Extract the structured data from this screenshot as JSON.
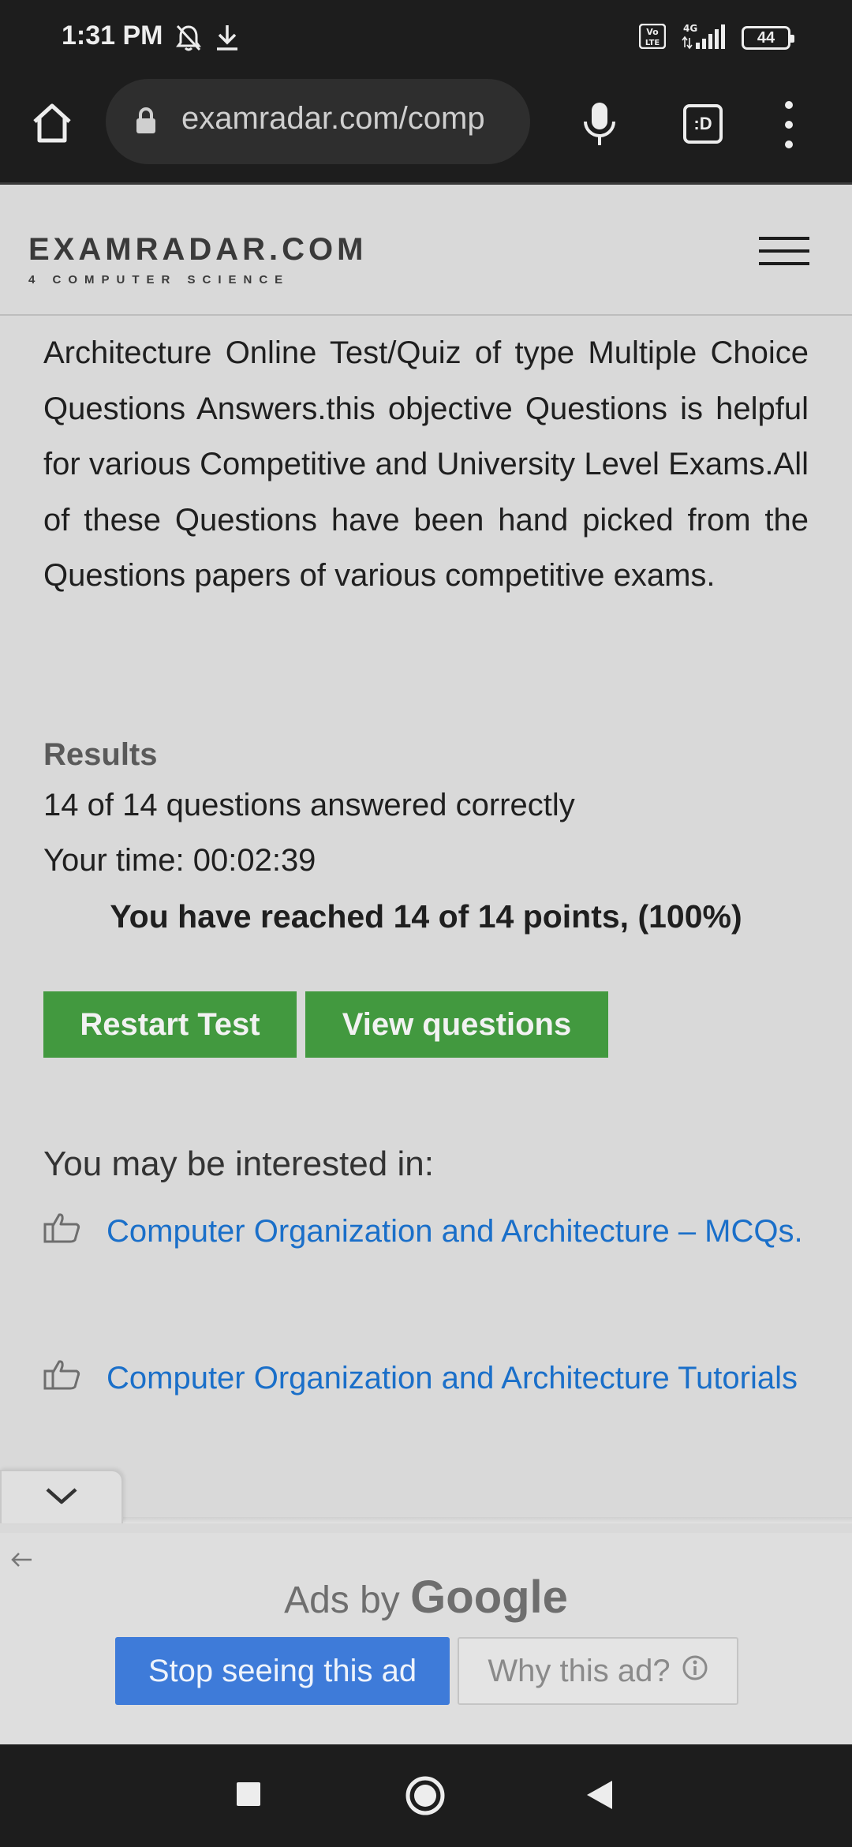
{
  "status_bar": {
    "time": "1:31 PM",
    "network": "4G",
    "battery": "44"
  },
  "browser": {
    "url": "examradar.com/comp",
    "tabs_label": ":D"
  },
  "site": {
    "logo_main": "EXAMRADAR.COM",
    "logo_sub": "4 COMPUTER SCIENCE"
  },
  "article": {
    "intro": "Architecture Online Test/Quiz of type Multiple Choice Questions Answers.this objective Questions is helpful for various Competitive and University Level Exams.All of these Questions have been hand picked from the Questions papers of various competitive exams."
  },
  "results": {
    "title": "Results",
    "answered": "14 of 14 questions answered correctly",
    "time": "Your time: 00:02:39",
    "score": "You have reached 14 of 14 points, (100%)",
    "restart_label": "Restart Test",
    "view_label": "View questions"
  },
  "interested": {
    "title": "You may be interested in:",
    "links": [
      "Computer Organization and Architecture – MCQs.",
      "Computer Organization and Architecture Tutorials"
    ]
  },
  "ad": {
    "ads_by": "Ads by",
    "brand": "Google",
    "stop_label": "Stop seeing this ad",
    "why_label": "Why this ad?"
  },
  "colors": {
    "accent_green": "#42993f",
    "link_blue": "#1a6fc9",
    "ad_blue": "#3e7bd9"
  }
}
